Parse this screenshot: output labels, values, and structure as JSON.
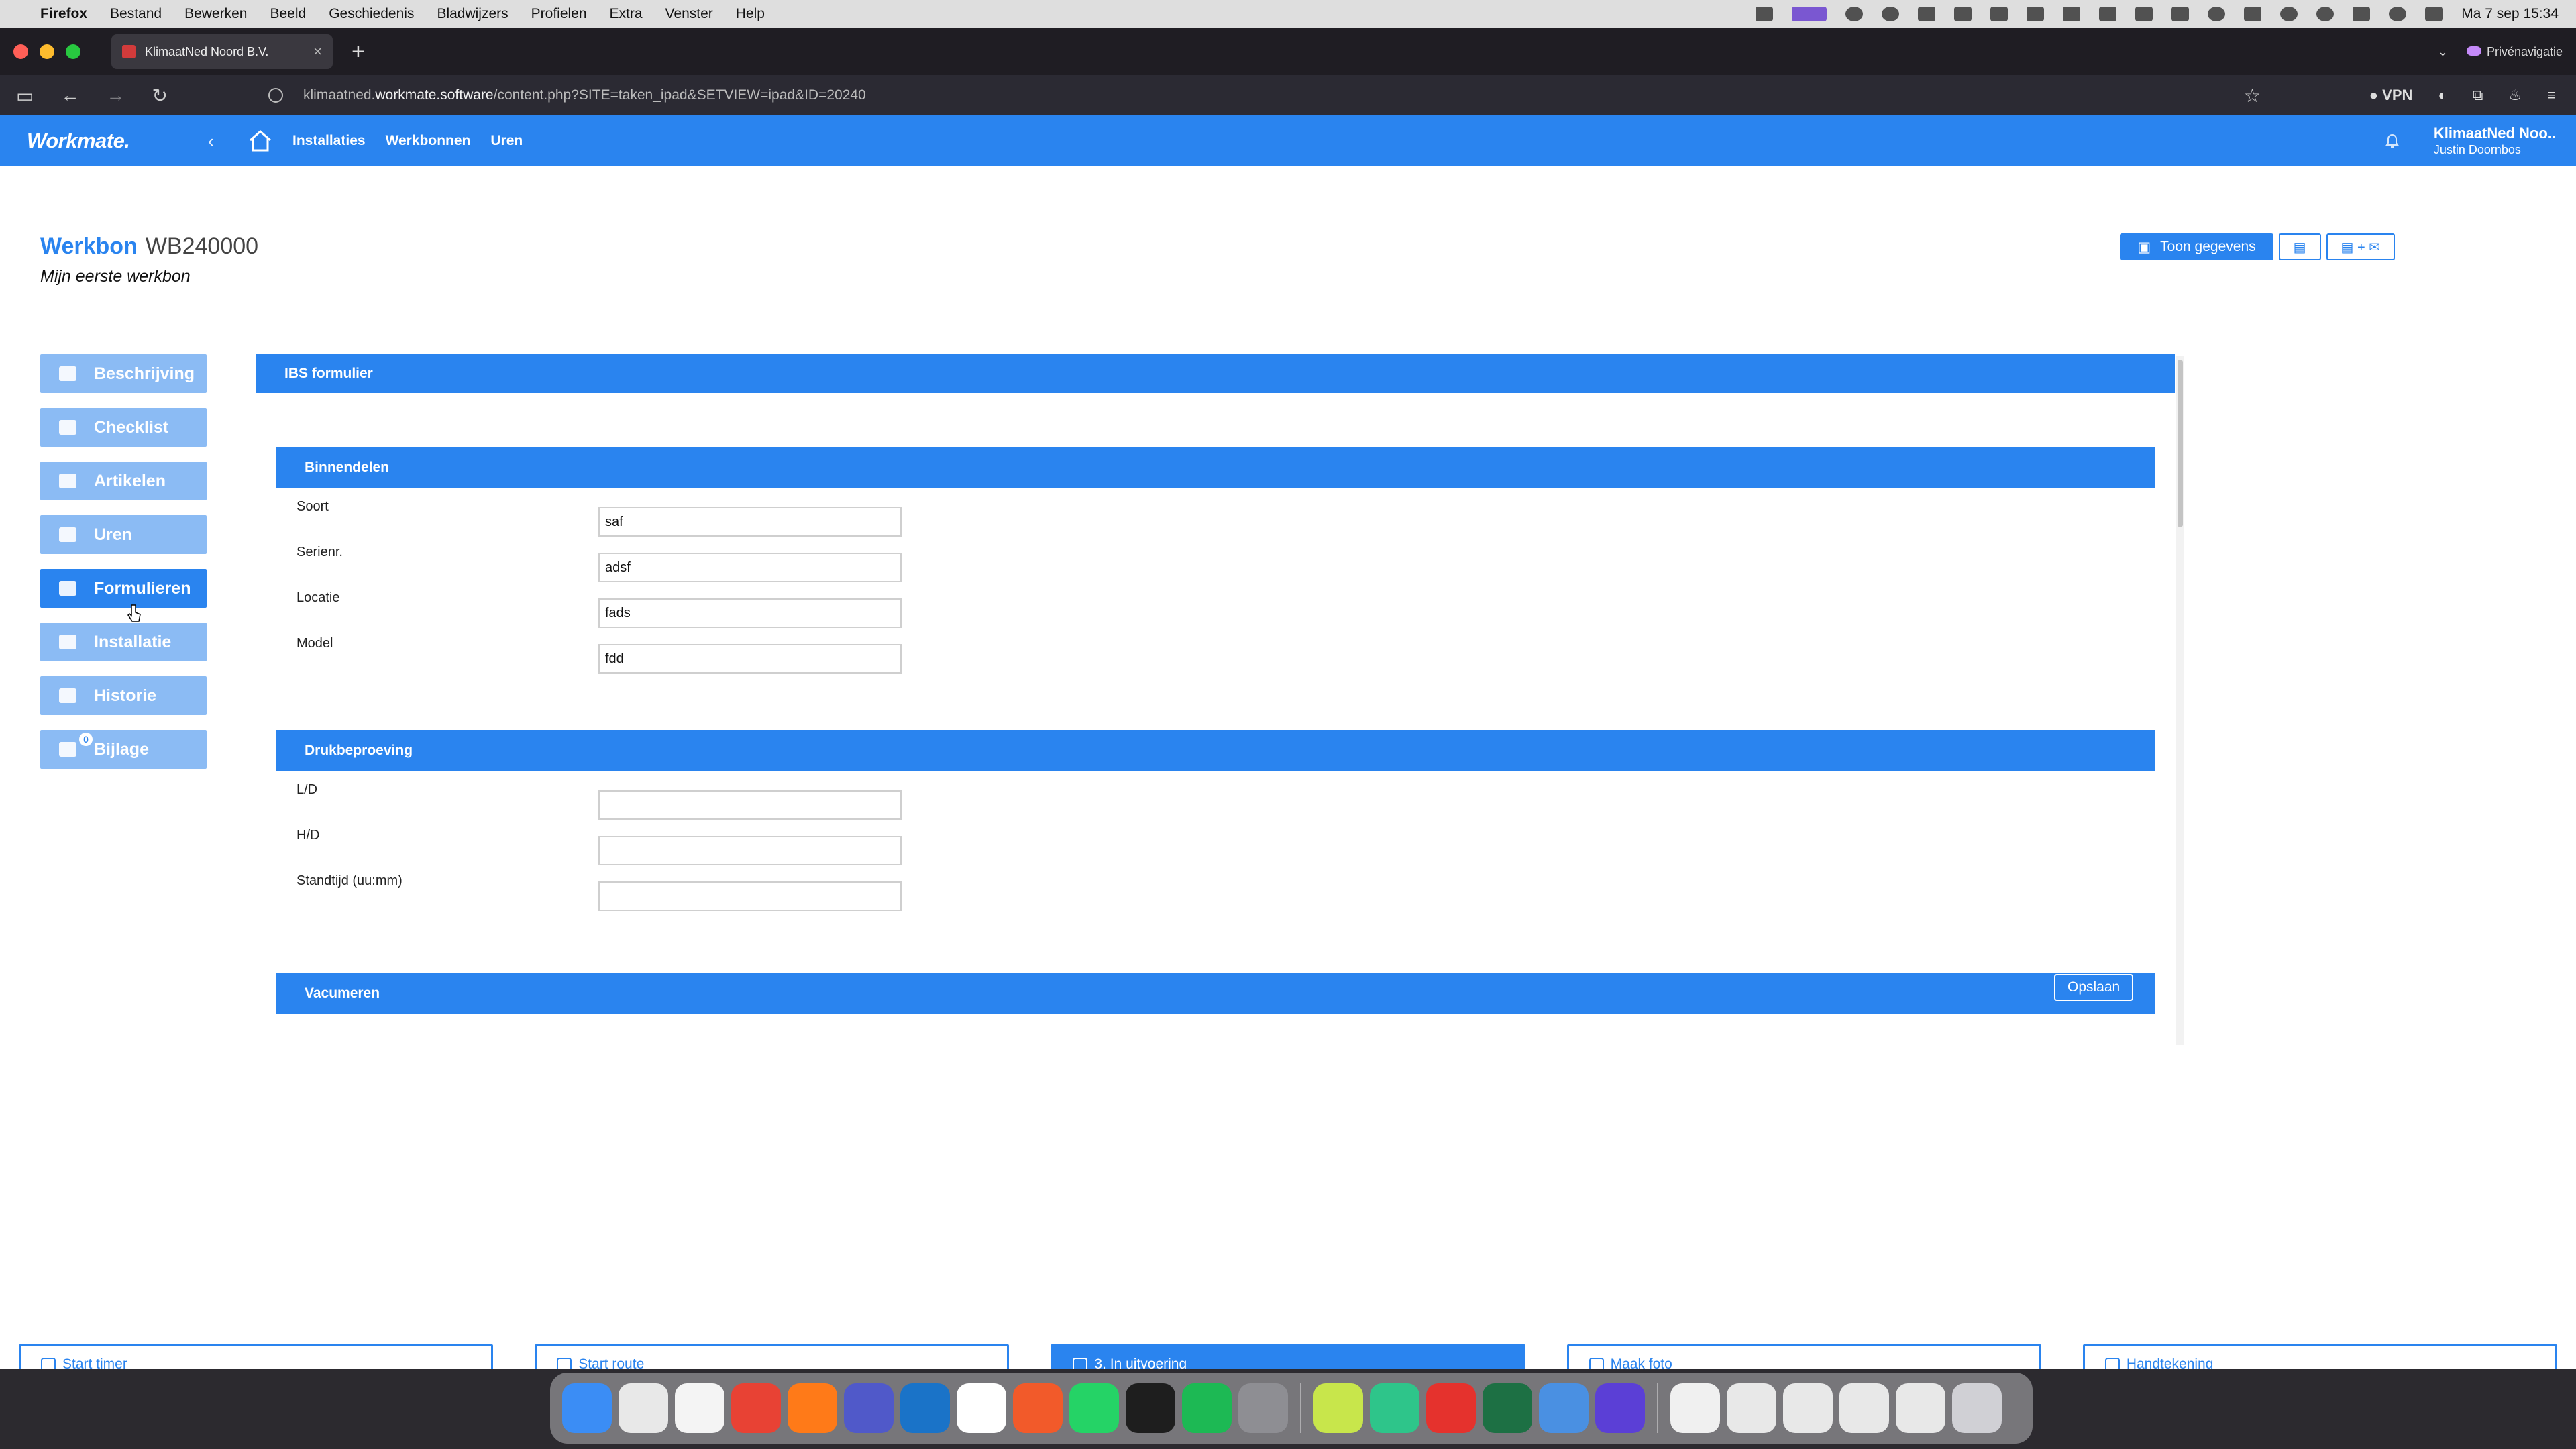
{
  "menubar": {
    "app": "Firefox",
    "items": [
      "Bestand",
      "Bewerken",
      "Beeld",
      "Geschiedenis",
      "Bladwijzers",
      "Profielen",
      "Extra",
      "Venster",
      "Help"
    ],
    "clock": "Ma 7 sep  15:34"
  },
  "browser": {
    "tab_title": "KlimaatNed Noord B.V.",
    "private_label": "Privénavigatie",
    "url_prefix": "klimaatned.",
    "url_host": "workmate.software",
    "url_path": "/content.php?SITE=taken_ipad&SETVIEW=ipad&ID=20240",
    "vpn_label": "VPN"
  },
  "app": {
    "logo": "Workmate.",
    "nav": [
      "Installaties",
      "Werkbonnen",
      "Uren"
    ],
    "company": "KlimaatNed Noo..",
    "user": "Justin Doornbos",
    "accent": "#2a84ef",
    "accent_light": "#8bbbf4"
  },
  "page": {
    "title_label": "Werkbon",
    "title_number": "WB240000",
    "subtitle": "Mijn eerste werkbon",
    "show_data_label": "Toon gegevens",
    "pdf_mail_label": "+ ✉"
  },
  "sidemenu": [
    {
      "label": "Beschrijving",
      "icon": "comment-icon"
    },
    {
      "label": "Checklist",
      "icon": "list-icon"
    },
    {
      "label": "Artikelen",
      "icon": "box-icon"
    },
    {
      "label": "Uren",
      "icon": "user-icon"
    },
    {
      "label": "Formulieren",
      "icon": "form-icon"
    },
    {
      "label": "Installatie",
      "icon": "chart-icon"
    },
    {
      "label": "Historie",
      "icon": "history-icon"
    },
    {
      "label": "Bijlage",
      "icon": "folder-icon",
      "badge": "0"
    }
  ],
  "form": {
    "title": "IBS formulier",
    "sections": [
      {
        "title": "Binnendelen",
        "fields": [
          {
            "label": "Soort",
            "value": "saf"
          },
          {
            "label": "Serienr.",
            "value": "adsf"
          },
          {
            "label": "Locatie",
            "value": "fads"
          },
          {
            "label": "Model",
            "value": "fdd"
          }
        ]
      },
      {
        "title": "Drukbeproeving",
        "fields": [
          {
            "label": "L/D",
            "value": ""
          },
          {
            "label": "H/D",
            "value": ""
          },
          {
            "label": "Standtijd (uu:mm)",
            "value": ""
          }
        ]
      },
      {
        "title": "Vacumeren",
        "fields": []
      }
    ],
    "save_label": "Opslaan"
  },
  "bottom_actions": [
    "Start timer",
    "Start route",
    "3. In uitvoering",
    "Maak foto",
    "Handtekening"
  ]
}
